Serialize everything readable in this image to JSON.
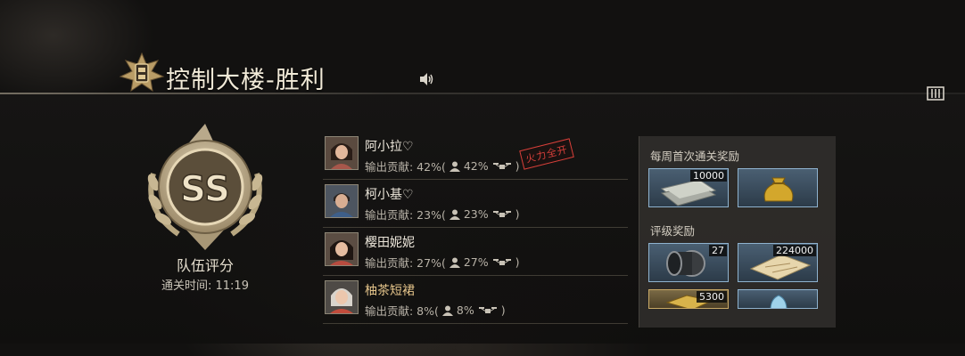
{
  "header": {
    "title": "控制大楼-胜利"
  },
  "rating": {
    "grade": "SS",
    "label": "队伍评分",
    "clear_time": "通关时间: 11:19"
  },
  "players": [
    {
      "name": "阿小拉♡",
      "contribution": "输出贡献: 42%(",
      "share": "42%",
      "tail": ")",
      "badge": "火力全开",
      "highlight": false
    },
    {
      "name": "柯小基♡",
      "contribution": "输出贡献: 23%(",
      "share": "23%",
      "tail": ")",
      "highlight": false
    },
    {
      "name": "樱田妮妮",
      "contribution": "输出贡献: 27%(",
      "share": "27%",
      "tail": ")",
      "highlight": false
    },
    {
      "name": "柚茶短裙",
      "contribution": "输出贡献: 8%(",
      "share": "8%",
      "tail": ")",
      "highlight": true
    }
  ],
  "rewards": {
    "weekly_title": "每周首次通关奖励",
    "weekly_items": [
      {
        "icon": "cash-stack-icon",
        "qty": "10000"
      },
      {
        "icon": "gold-pouch-icon",
        "qty": ""
      }
    ],
    "grade_title": "评级奖励",
    "grade_items": [
      {
        "icon": "tire-roll-icon",
        "qty": "27"
      },
      {
        "icon": "blueprint-map-icon",
        "qty": "224000"
      },
      {
        "icon": "gold-bar-icon",
        "qty": "5300"
      },
      {
        "icon": "crystal-icon",
        "qty": ""
      }
    ]
  },
  "colors": {
    "accent_gold": "#e4c48a",
    "tile_border": "#8fb3cf",
    "stamp_red": "#d8403a"
  }
}
